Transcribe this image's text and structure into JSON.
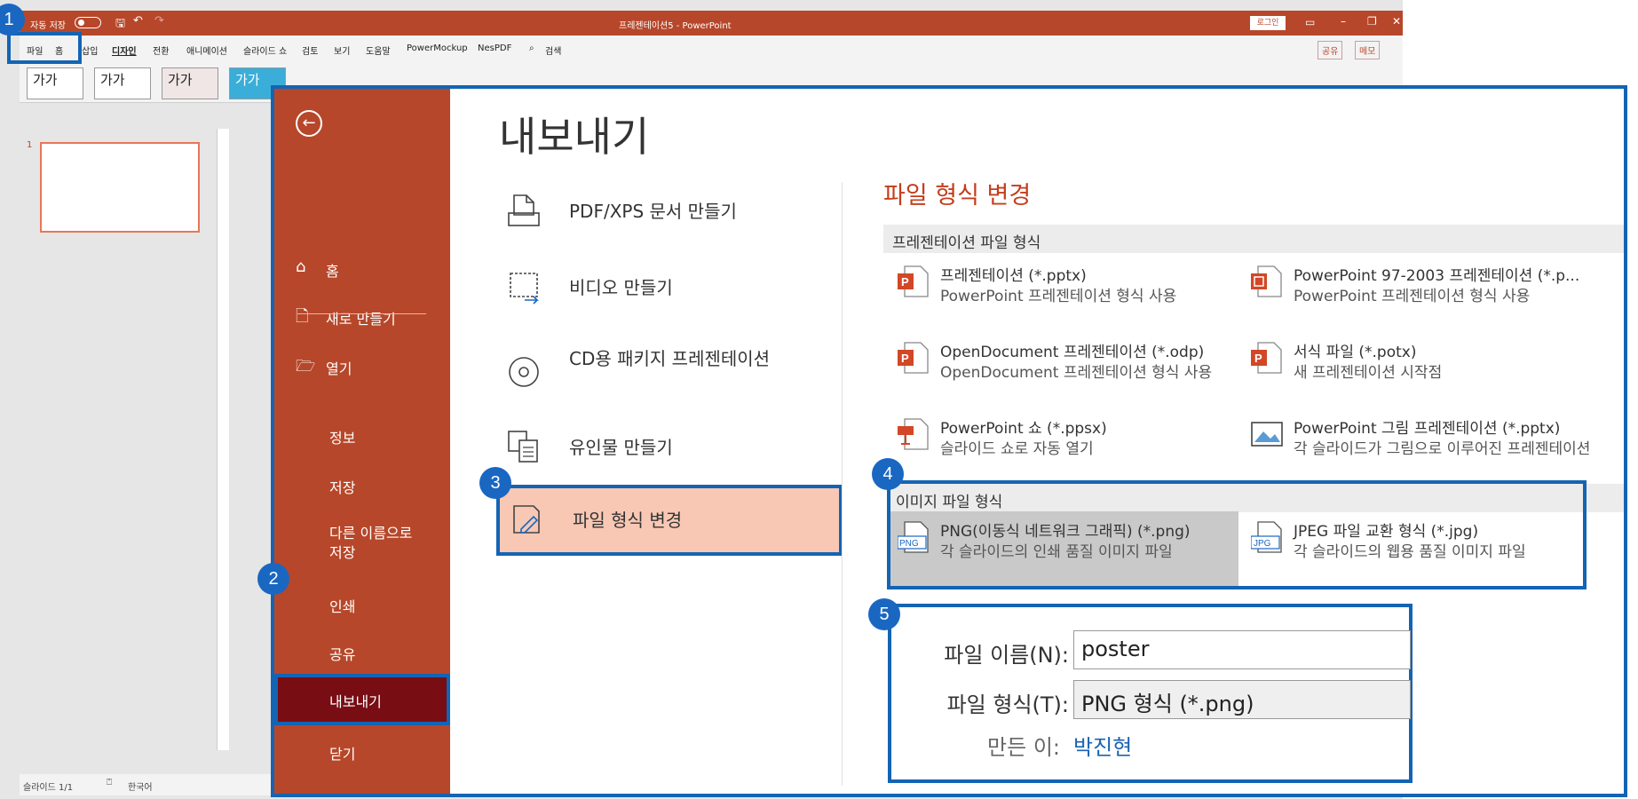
{
  "app": {
    "title": "프레젠테이션5  -  PowerPoint",
    "autosave_label": "자동 저장",
    "login_label": "로그인",
    "share_label": "공유",
    "memo_label": "메모"
  },
  "menu": {
    "tabs": [
      "파일",
      "홈",
      "삽입",
      "디자인",
      "전환",
      "애니메이션",
      "슬라이드 쇼",
      "검토",
      "보기",
      "도움말",
      "PowerMockup",
      "NesPDF"
    ],
    "search_label": "검색"
  },
  "ribbon": {
    "theme_sample_text": "가가"
  },
  "slides": {
    "thumb_number": "1"
  },
  "statusbar": {
    "slide_info": "슬라이드 1/1",
    "language": "한국어"
  },
  "backstage": {
    "title": "내보내기",
    "nav": {
      "home": "홈",
      "new": "새로 만들기",
      "open": "열기",
      "info": "정보",
      "save": "저장",
      "save_as": "다른 이름으로 저장",
      "print": "인쇄",
      "share": "공유",
      "export": "내보내기",
      "close": "닫기"
    },
    "export_options": {
      "pdf": "PDF/XPS 문서 만들기",
      "video": "비디오 만들기",
      "cd": "CD용 패키지 프레젠테이션",
      "handout": "유인물 만들기",
      "change_type": "파일 형식 변경"
    },
    "file_types": {
      "heading": "파일 형식 변경",
      "presentation_section": "프레젠테이션 파일 형식",
      "pptx_name": "프레젠테이션 (*.pptx)",
      "pptx_desc": "PowerPoint 프레젠테이션 형식 사용",
      "ppt_name": "PowerPoint 97-2003 프레젠테이션 (*.p...",
      "ppt_desc": "PowerPoint 프레젠테이션 형식 사용",
      "odp_name": "OpenDocument 프레젠테이션 (*.odp)",
      "odp_desc": "OpenDocument 프레젠테이션 형식 사용",
      "potx_name": "서식 파일 (*.potx)",
      "potx_desc": "새 프레젠테이션 시작점",
      "ppsx_name": "PowerPoint 쇼 (*.ppsx)",
      "ppsx_desc": "슬라이드 쇼로 자동 열기",
      "pic_name": "PowerPoint 그림 프레젠테이션 (*.pptx)",
      "pic_desc": "각 슬라이드가 그림으로 이루어진 프레젠테이션",
      "image_section": "이미지 파일 형식",
      "png_name": "PNG(이동식 네트워크 그래픽) (*.png)",
      "png_desc": "각 슬라이드의 인쇄 품질 이미지 파일",
      "jpg_name": "JPEG 파일 교환 형식 (*.jpg)",
      "jpg_desc": "각 슬라이드의 웹용 품질 이미지 파일",
      "png_badge": "PNG",
      "jpg_badge": "JPG"
    }
  },
  "save_dialog": {
    "filename_label": "파일 이름(N):",
    "filename_value": "poster",
    "filetype_label": "파일 형식(T):",
    "filetype_value": "PNG 형식 (*.png)",
    "author_label": "만든 이:",
    "author_value": "박진현"
  },
  "steps": [
    "1",
    "2",
    "3",
    "4",
    "5"
  ],
  "colors": {
    "accent": "#b7472a",
    "highlight": "#1464b4",
    "nav_selected": "#780d14",
    "option_selected": "#f8c8b4"
  }
}
